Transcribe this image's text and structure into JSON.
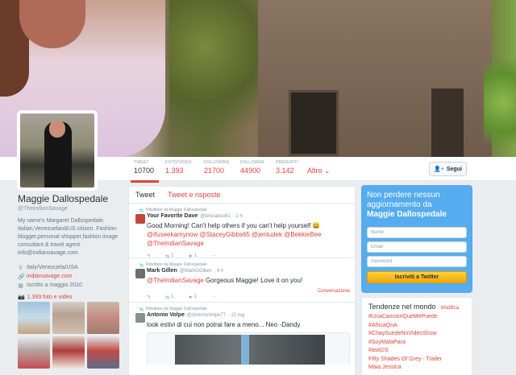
{
  "profile": {
    "name": "Maggie Dallospedale",
    "handle": "@TheIndianSavage",
    "bio": "My name's Margaret Dallospedale. Italian,Venezuelan&US citizen. Fashion blogger,personal shopper,fashion image consultant & travel agent. info@indiansavage.com",
    "location": "Italy/Venezuela/USA",
    "website": "indiansavage.com",
    "joined": "Iscritto a maggio 2010",
    "photos_link": "1.393 foto e video"
  },
  "nav": {
    "items": [
      {
        "label": "TWEET",
        "value": "10700"
      },
      {
        "label": "FOTO/VIDEO",
        "value": "1.393"
      },
      {
        "label": "FOLLOWING",
        "value": "21700"
      },
      {
        "label": "FOLLOWER",
        "value": "44900"
      },
      {
        "label": "PREFERITI",
        "value": "3.142"
      }
    ],
    "more": "Altro",
    "follow": "Segui"
  },
  "timeline": {
    "tabs": [
      "Tweet",
      "Tweet e risposte"
    ],
    "tweets": [
      {
        "retweet_label": "Ritwittato da Maggie Dallospedale",
        "name": "Your Favorite Dave",
        "handle": "@dmcadoo81",
        "time": "· 2 h",
        "text_plain": "Good Morning! Can't help others if you can't help yourself 😀",
        "mentions": "@ifuseekamynow @StaceyGibbs65 @jenludek @BekkieBee @TheIndianSavage",
        "retweets": "1",
        "favorites": "1",
        "avatar_color": "#c2463b"
      },
      {
        "retweet_label": "Ritwittato da Maggie Dallospedale",
        "name": "Mark Gillen",
        "handle": "@MarkGGillen",
        "time": "· 4 h",
        "mention": "@TheIndianSavage",
        "text_plain": " Gorgeous Maggie!  Love it on you!",
        "conversation": "Conversazione",
        "retweets": "1",
        "favorites": "1",
        "avatar_color": "#6b6f73"
      },
      {
        "retweet_label": "Ritwittato da Maggie Dallospedale",
        "name": "Antonio Volpe",
        "handle": "@AntonioVolpe77",
        "time": "· 22 lug",
        "text_plain": "look estivi di cui non potrai fare a meno... Neo -Dandy",
        "avatar_color": "#8a8f94"
      }
    ]
  },
  "signup": {
    "title": "Non perdere nessun aggiornamento da",
    "name": "Maggie Dallospedale",
    "name_placeholder": "Nome",
    "email_placeholder": "Email",
    "password_placeholder": "Password",
    "button": "Iscriviti a Twitter"
  },
  "trends": {
    "title": "Tendenze nel mondo",
    "change": "· Modifica",
    "items": [
      "#UnaCancionQueMePuede",
      "#AfricaQnA",
      "#ChaySuedeNoVideoShow",
      "#SoyMalaPara",
      "#askDS",
      "Fifty Shades Of Grey - Trailer",
      "Maia Jessica"
    ]
  },
  "colors": {
    "accent": "#e0433a",
    "signup_bg": "#55acee",
    "signup_button": "#ffd23c"
  }
}
